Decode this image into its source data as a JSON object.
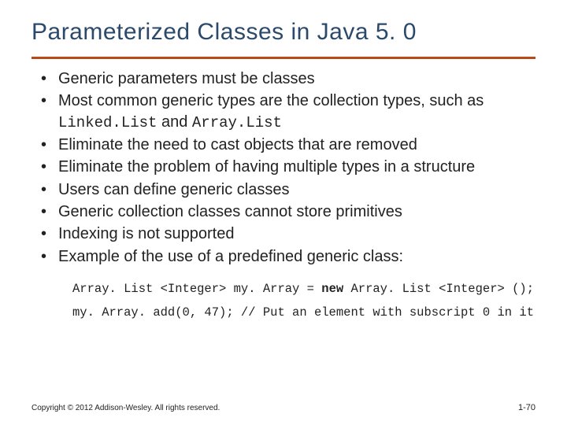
{
  "title": "Parameterized Classes in Java 5. 0",
  "bullets": [
    {
      "pre": "Generic parameters must be classes",
      "code": "",
      "post": ""
    },
    {
      "pre": "Most common generic types are the collection types, such as ",
      "code": "Linked.List",
      "mid": " and ",
      "code2": "Array.List",
      "post": ""
    },
    {
      "pre": "Eliminate the need to cast objects that are removed",
      "code": "",
      "post": ""
    },
    {
      "pre": "Eliminate the problem of having multiple types in a structure",
      "code": "",
      "post": ""
    },
    {
      "pre": "Users can define generic classes",
      "code": "",
      "post": ""
    },
    {
      "pre": "Generic collection classes cannot store primitives",
      "code": "",
      "post": ""
    },
    {
      "pre": "Indexing is not supported",
      "code": "",
      "post": ""
    },
    {
      "pre": "Example of the use of a predefined generic class:",
      "code": "",
      "post": ""
    }
  ],
  "code": {
    "line1_a": "Array. List <Integer> my. Array = ",
    "line1_kw": "new",
    "line1_b": " Array. List <Integer> ();",
    "line2": "my. Array. add(0, 47);  // Put an element with subscript 0 in it"
  },
  "footer": {
    "copyright": "Copyright © 2012 Addison-Wesley. All rights reserved.",
    "page": "1-70"
  }
}
